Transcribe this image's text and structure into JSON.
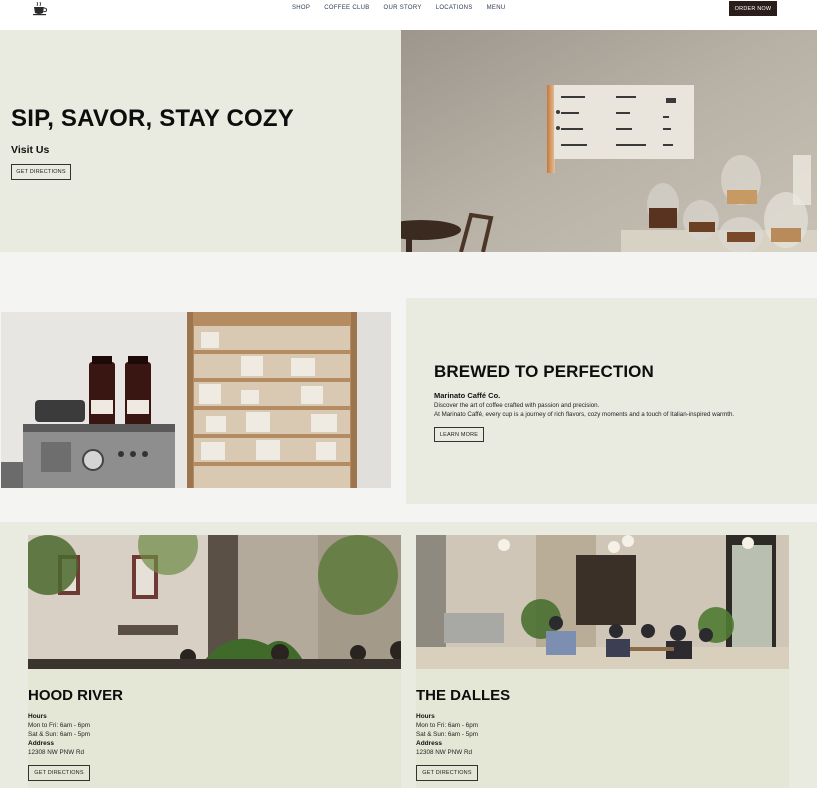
{
  "nav": {
    "logo_icon": "coffee-cup-icon",
    "links": [
      "SHOP",
      "COFFEE CLUB",
      "OUR STORY",
      "LOCATIONS",
      "MENU"
    ],
    "order_button": "ORDER NOW"
  },
  "hero": {
    "title": "SIP, SAVOR, STAY COZY",
    "subtitle": "Visit Us",
    "button": "GET DIRECTIONS"
  },
  "brew": {
    "title": "BREWED TO PERFECTION",
    "company": "Marinato Caffé Co.",
    "line1": "Discover the art of coffee crafted with passion and precision.",
    "line2": "At Marinato Caffé, every cup is a journey of rich flavors, cozy moments and a touch of Italian-inspired warmth.",
    "button": "LEARN MORE"
  },
  "locations": [
    {
      "name": "HOOD RIVER",
      "hours_label": "Hours",
      "hours_weekday": "Mon to Fri: 6am - 6pm",
      "hours_weekend": "Sat & Sun: 6am - 5pm",
      "address_label": "Address",
      "address": "12308 NW PNW Rd",
      "button": "GET DIRECTIONS"
    },
    {
      "name": "THE DALLES",
      "hours_label": "Hours",
      "hours_weekday": "Mon to Fri: 6am - 6pm",
      "hours_weekend": "Sat & Sun: 6am - 5pm",
      "address_label": "Address",
      "address": "12308 NW PNW Rd",
      "button": "GET DIRECTIONS"
    }
  ],
  "colors": {
    "nav_bg": "#ffffff",
    "panel_bg": "#eaebe0",
    "page_bg": "#f4f4f3",
    "order_button_bg": "#2b1d1a",
    "nav_link": "#2d3b4f"
  }
}
